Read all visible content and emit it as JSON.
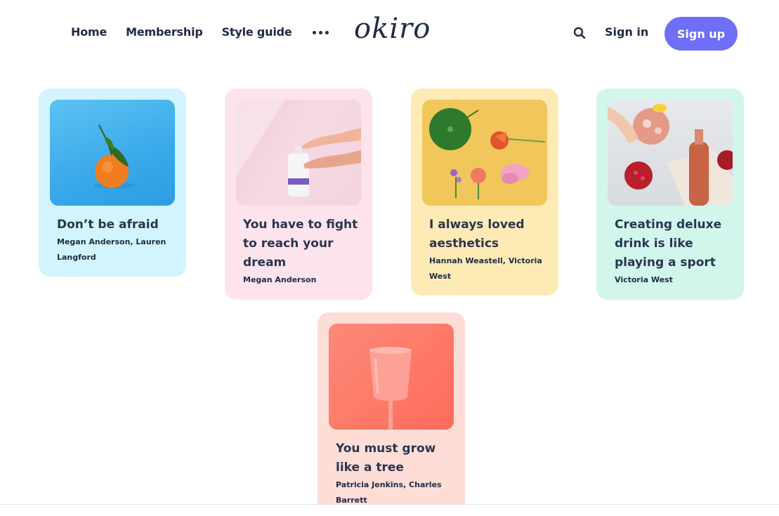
{
  "header": {
    "nav": [
      "Home",
      "Membership",
      "Style guide"
    ],
    "logo": "okiro",
    "sign_in": "Sign in",
    "sign_up": "Sign up"
  },
  "colors": {
    "accent": "#6e6ef7",
    "text": "#1f2a44"
  },
  "cards": [
    {
      "title": "Don’t be afraid",
      "authors": "Megan Anderson, Lauren Langford",
      "bg": "#d3f4fc",
      "image_icon": "mandarin-orange-image"
    },
    {
      "title": "You have to fight to reach your dream",
      "authors": "Megan Anderson",
      "bg": "#fde3ec",
      "image_icon": "hand-lotion-image"
    },
    {
      "title": "I always loved aesthetics",
      "authors": "Hannah Weastell, Victoria West",
      "bg": "#feeab5",
      "image_icon": "flowers-image"
    },
    {
      "title": "Creating deluxe drink is like playing a sport",
      "authors": "Victoria West",
      "bg": "#d2f6ec",
      "image_icon": "drink-pomegranate-image"
    },
    {
      "title": "You must grow like a tree",
      "authors": "Patricia Jenkins, Charles Barrett",
      "bg": "#fdddd6",
      "image_icon": "wine-glass-image"
    }
  ]
}
